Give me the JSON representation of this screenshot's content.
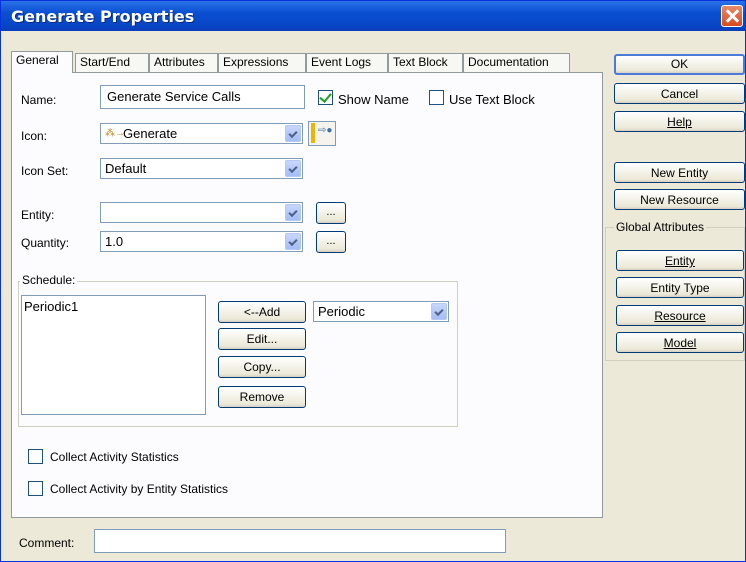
{
  "window": {
    "title": "Generate Properties"
  },
  "tabs": [
    {
      "label": "General"
    },
    {
      "label": "Start/End"
    },
    {
      "label": "Attributes"
    },
    {
      "label": "Expressions"
    },
    {
      "label": "Event Logs"
    },
    {
      "label": "Text Block"
    },
    {
      "label": "Documentation"
    }
  ],
  "general": {
    "name_label": "Name:",
    "name_value": "Generate Service Calls",
    "show_name_label": "Show Name",
    "show_name_checked": true,
    "use_text_block_label": "Use Text Block",
    "use_text_block_checked": false,
    "icon_label": "Icon:",
    "icon_value": "Generate",
    "icon_set_label": "Icon Set:",
    "icon_set_value": "Default",
    "entity_label": "Entity:",
    "entity_value": "",
    "entity_browse": "...",
    "quantity_label": "Quantity:",
    "quantity_value": "1.0",
    "quantity_browse": "..."
  },
  "schedule": {
    "legend": "Schedule:",
    "items": [
      "Periodic1"
    ],
    "add_label": "<--Add",
    "edit_label": "Edit...",
    "copy_label": "Copy...",
    "remove_label": "Remove",
    "type_value": "Periodic"
  },
  "options": {
    "collect_activity_label": "Collect Activity Statistics",
    "collect_entity_label": "Collect Activity by Entity Statistics"
  },
  "comment": {
    "label": "Comment:",
    "value": ""
  },
  "right_panel": {
    "ok": "OK",
    "cancel": "Cancel",
    "help": "Help",
    "new_entity": "New Entity",
    "new_resource": "New Resource",
    "global_attributes_legend": "Global Attributes",
    "entity": "Entity",
    "entity_type": "Entity Type",
    "resource": "Resource",
    "model": "Model"
  }
}
